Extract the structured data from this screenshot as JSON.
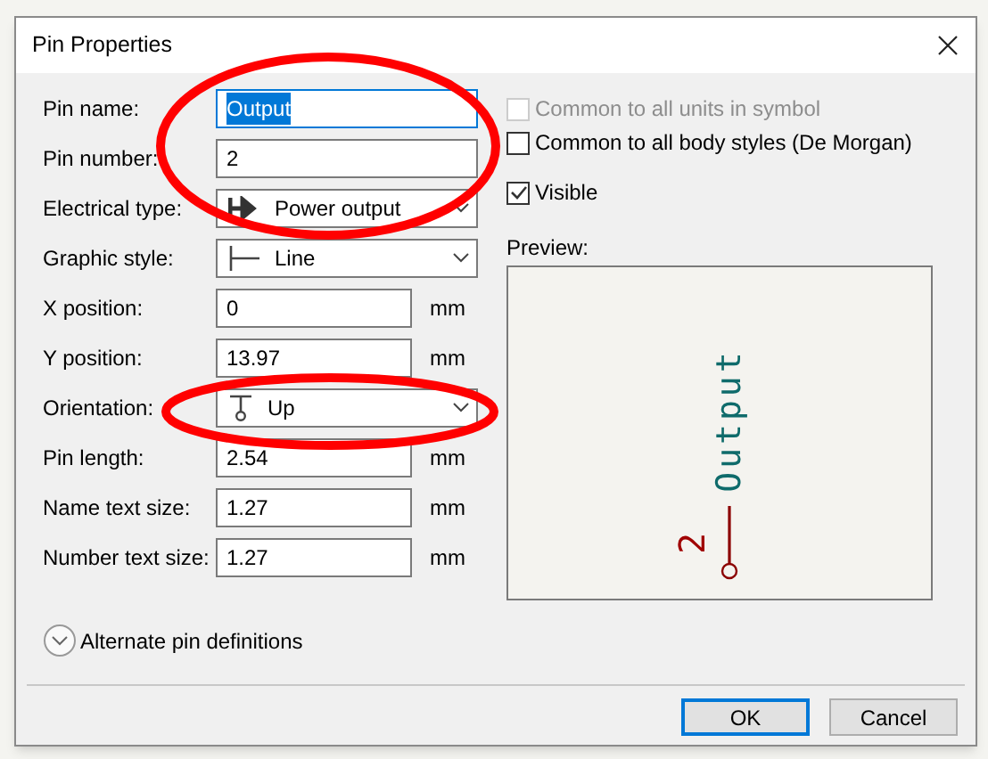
{
  "window": {
    "title": "Pin Properties"
  },
  "fields": [
    {
      "kind": "text",
      "label": "Pin name:",
      "value": "Output",
      "highlighted": true
    },
    {
      "kind": "text",
      "label": "Pin number:",
      "value": "2",
      "highlighted": false
    },
    {
      "kind": "select",
      "label": "Electrical type:",
      "value": "Power output"
    },
    {
      "kind": "select",
      "label": "Graphic style:",
      "value": "Line"
    },
    {
      "kind": "measure",
      "label": "X position:",
      "value": "0",
      "unit": "mm"
    },
    {
      "kind": "measure",
      "label": "Y position:",
      "value": "13.97",
      "unit": "mm"
    },
    {
      "kind": "select",
      "label": "Orientation:",
      "value": "Up"
    },
    {
      "kind": "measure",
      "label": "Pin length:",
      "value": "2.54",
      "unit": "mm"
    },
    {
      "kind": "measure",
      "label": "Name text size:",
      "value": "1.27",
      "unit": "mm"
    },
    {
      "kind": "measure",
      "label": "Number text size:",
      "value": "1.27",
      "unit": "mm"
    }
  ],
  "checkboxes": [
    {
      "label": "Common to all units in symbol",
      "checked": false,
      "disabled": true
    },
    {
      "label": "Common to all body styles (De Morgan)",
      "checked": false,
      "disabled": false
    },
    {
      "label": "Visible",
      "checked": true,
      "disabled": false
    }
  ],
  "preview": {
    "label": "Preview:",
    "pin_name": "Output",
    "pin_number": "2"
  },
  "expander": {
    "label": "Alternate pin definitions",
    "expanded": false
  },
  "buttons": [
    {
      "label": "OK",
      "default": true
    },
    {
      "label": "Cancel",
      "default": false
    }
  ]
}
